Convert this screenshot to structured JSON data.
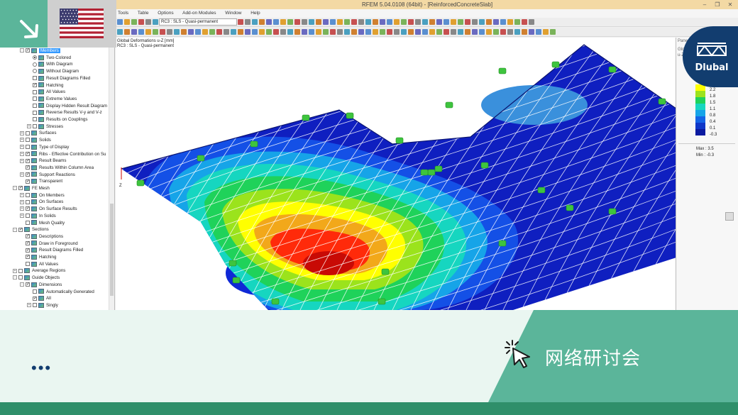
{
  "window": {
    "title": "RFEM 5.04.0108 (64bit) - [ReinforcedConcreteSlab]",
    "controls": [
      "–",
      "❐",
      "✕"
    ]
  },
  "menu": {
    "items": [
      "Tools",
      "Table",
      "Options",
      "Add-on Modules",
      "Window",
      "Help"
    ]
  },
  "toolbar": {
    "load_combo_value": "RC3 : SLS - Quasi-permanent"
  },
  "viewport": {
    "caption_line1": "Global Deformations u-Z [mm]",
    "caption_line2": "RC3 : SLS - Quasi-permanent",
    "axis_label": "Z"
  },
  "right_panel": {
    "header_partial": "Pane",
    "sub_partial_1": "Glo",
    "sub_partial_2": "u-Z",
    "legend_values": [
      "2.2",
      "1.8",
      "1.5",
      "1.1",
      "0.8",
      "0.4",
      "0.1",
      "-0.3"
    ],
    "legend_colors": [
      "#ffff00",
      "#9be31c",
      "#1fd25a",
      "#16d6c0",
      "#16a4e8",
      "#1464e6",
      "#0f37c8",
      "#0a1aa0"
    ],
    "max_label": "Max",
    "max_value": "3.5",
    "min_label": "Min",
    "min_value": "-0.3"
  },
  "tree": {
    "nodes": [
      {
        "label": "Members",
        "level": 2,
        "kind": "check",
        "checked": true,
        "expand": "-",
        "selected": true
      },
      {
        "label": "Two-Colored",
        "level": 3,
        "kind": "radio",
        "checked": true
      },
      {
        "label": "With Diagram",
        "level": 3,
        "kind": "radio",
        "checked": false
      },
      {
        "label": "Without Diagram",
        "level": 3,
        "kind": "radio",
        "checked": false
      },
      {
        "label": "Result Diagrams Filled",
        "level": 3,
        "kind": "check",
        "checked": false
      },
      {
        "label": "Hatching",
        "level": 3,
        "kind": "check",
        "checked": true
      },
      {
        "label": "All Values",
        "level": 3,
        "kind": "check",
        "checked": false
      },
      {
        "label": "Extreme Values",
        "level": 3,
        "kind": "check",
        "checked": false
      },
      {
        "label": "Display Hidden Result Diagram",
        "level": 3,
        "kind": "check",
        "checked": false
      },
      {
        "label": "Reverse Results V-y and V-z",
        "level": 3,
        "kind": "check",
        "checked": false
      },
      {
        "label": "Results on Couplings",
        "level": 3,
        "kind": "check",
        "checked": false
      },
      {
        "label": "Stresses",
        "level": 3,
        "kind": "check",
        "checked": false,
        "expand": "+"
      },
      {
        "label": "Surfaces",
        "level": 2,
        "kind": "check",
        "checked": false,
        "expand": "+"
      },
      {
        "label": "Solids",
        "level": 2,
        "kind": "check",
        "checked": false,
        "expand": "+"
      },
      {
        "label": "Type of Display",
        "level": 2,
        "kind": "check",
        "checked": false,
        "expand": "+"
      },
      {
        "label": "Ribs - Effective Contribution on Su",
        "level": 2,
        "kind": "check",
        "checked": true,
        "expand": "+"
      },
      {
        "label": "Result Beams",
        "level": 2,
        "kind": "check",
        "checked": true,
        "expand": "+"
      },
      {
        "label": "Results Within Column Area",
        "level": 2,
        "kind": "check",
        "checked": true
      },
      {
        "label": "Support Reactions",
        "level": 2,
        "kind": "check",
        "checked": true,
        "expand": "+"
      },
      {
        "label": "Transparent",
        "level": 2,
        "kind": "check",
        "checked": true
      },
      {
        "label": "FE Mesh",
        "level": 1,
        "kind": "check",
        "checked": true,
        "expand": "-"
      },
      {
        "label": "On Members",
        "level": 2,
        "kind": "check",
        "checked": false,
        "expand": "+"
      },
      {
        "label": "On Surfaces",
        "level": 2,
        "kind": "check",
        "checked": false,
        "expand": "+"
      },
      {
        "label": "On Surface Results",
        "level": 2,
        "kind": "check",
        "checked": true,
        "expand": "+"
      },
      {
        "label": "In Solids",
        "level": 2,
        "kind": "check",
        "checked": false,
        "expand": "+"
      },
      {
        "label": "Mesh Quality",
        "level": 2,
        "kind": "check",
        "checked": false
      },
      {
        "label": "Sections",
        "level": 1,
        "kind": "check",
        "checked": true,
        "expand": "-"
      },
      {
        "label": "Descriptions",
        "level": 2,
        "kind": "check",
        "checked": true
      },
      {
        "label": "Draw in Foreground",
        "level": 2,
        "kind": "check",
        "checked": true
      },
      {
        "label": "Result Diagrams Filled",
        "level": 2,
        "kind": "check",
        "checked": true
      },
      {
        "label": "Hatching",
        "level": 2,
        "kind": "check",
        "checked": true
      },
      {
        "label": "All Values",
        "level": 2,
        "kind": "check",
        "checked": false
      },
      {
        "label": "Average Regions",
        "level": 1,
        "kind": "check",
        "checked": false,
        "expand": "+"
      },
      {
        "label": "Guide Objects",
        "level": 1,
        "kind": "check",
        "checked": false,
        "expand": "-"
      },
      {
        "label": "Dimensions",
        "level": 2,
        "kind": "check",
        "checked": true,
        "expand": "-"
      },
      {
        "label": "Automatically Generated",
        "level": 3,
        "kind": "check",
        "checked": false
      },
      {
        "label": "All",
        "level": 3,
        "kind": "check",
        "checked": true
      },
      {
        "label": "Singly",
        "level": 3,
        "kind": "check",
        "checked": false,
        "expand": "+"
      }
    ]
  },
  "brand": {
    "name": "Dlubal",
    "primary": "#123d6f",
    "green": "#5bb59a",
    "dark_green": "#2f8f6a"
  },
  "overlay": {
    "language_flag": "us-flag-icon",
    "arrow_icon": "arrow-down-right-icon"
  },
  "banner": {
    "dots": "•••",
    "webinar_label": "网络研讨会",
    "cursor_icon": "click-cursor-icon"
  }
}
